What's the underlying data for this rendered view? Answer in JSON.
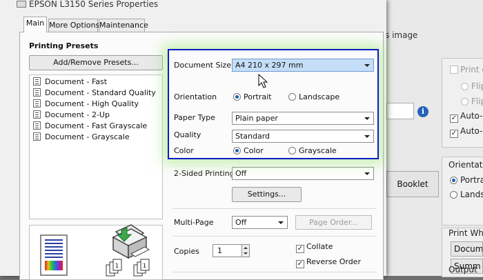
{
  "background_window": {
    "close_glyph": "✕",
    "image_label": "s image",
    "print_on_label": "Print o",
    "flip_label_1": "Flip",
    "flip_label_2": "Flip",
    "auto_label_1": "Auto-R",
    "auto_label_2": "Auto-C",
    "booklet_label": "Booklet",
    "orientation_label": "Orientatio",
    "portrait_label": "Portrai",
    "landscape_label": "Landsc",
    "print_what_label": "Print Wha",
    "document_btn": "Documer",
    "summary_btn": "Summ",
    "output_label": "Output"
  },
  "dialog": {
    "title": "EPSON L3150 Series Properties",
    "tabs": [
      {
        "label": "Main",
        "active": true
      },
      {
        "label": "More Options",
        "active": false
      },
      {
        "label": "Maintenance",
        "active": false
      }
    ],
    "presets": {
      "heading": "Printing Presets",
      "add_remove_label": "Add/Remove Presets...",
      "items": [
        "Document - Fast",
        "Document - Standard Quality",
        "Document - High Quality",
        "Document - 2-Up",
        "Document - Fast Grayscale",
        "Document - Grayscale"
      ]
    },
    "settings": {
      "document_size": {
        "label": "Document Size",
        "value": "A4 210 x 297 mm"
      },
      "orientation": {
        "label": "Orientation",
        "options": [
          "Portrait",
          "Landscape"
        ],
        "selected": "Portrait"
      },
      "paper_type": {
        "label": "Paper Type",
        "value": "Plain paper"
      },
      "quality": {
        "label": "Quality",
        "value": "Standard"
      },
      "color": {
        "label": "Color",
        "options": [
          "Color",
          "Grayscale"
        ],
        "selected": "Color"
      },
      "two_sided": {
        "label": "2-Sided Printing",
        "value": "Off"
      },
      "settings_button": "Settings...",
      "multi_page": {
        "label": "Multi-Page",
        "value": "Off"
      },
      "page_order_button": "Page Order...",
      "copies": {
        "label": "Copies",
        "value": "1"
      },
      "collate": {
        "label": "Collate",
        "checked": true
      },
      "reverse_order": {
        "label": "Reverse Order",
        "checked": true
      }
    }
  },
  "colors": {
    "highlight_border": "#0a1dbf",
    "highlight_glow": "#96e66e",
    "selected_field": "#c5def7",
    "radio_dot": "#1b5fb3",
    "close_button": "#c8453a",
    "info_icon": "#2463b8"
  }
}
